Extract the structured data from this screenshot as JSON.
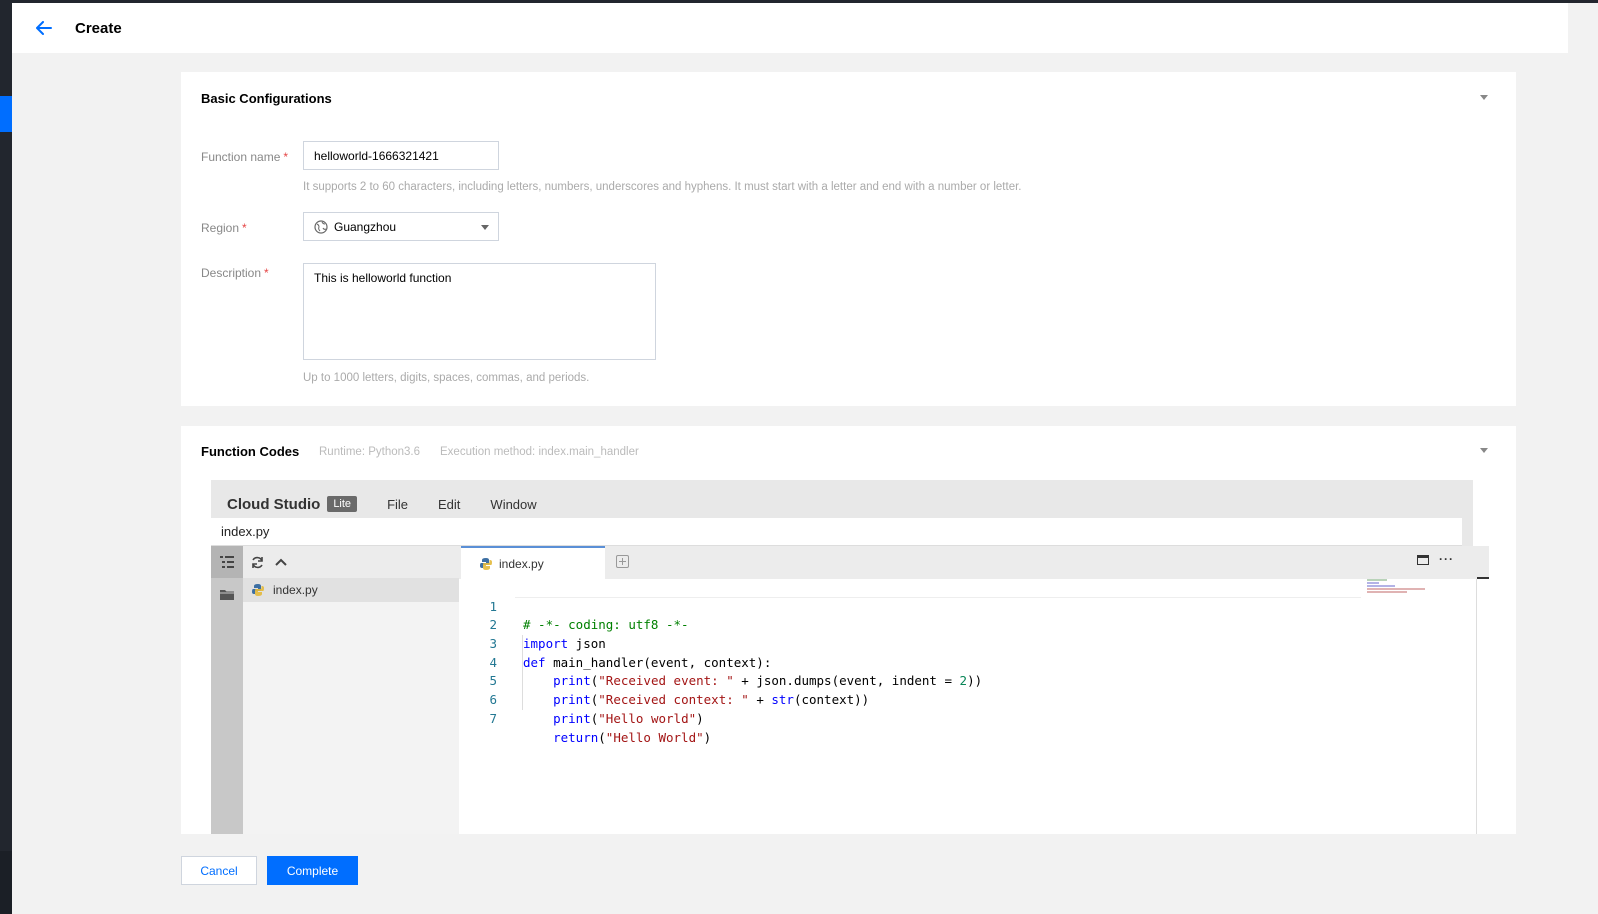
{
  "header": {
    "title": "Create"
  },
  "basic": {
    "title": "Basic Configurations",
    "function_name": {
      "label": "Function name",
      "required_mark": "*",
      "value": "helloworld-1666321421",
      "hint": "It supports 2 to 60 characters, including letters, numbers, underscores and hyphens. It must start with a letter and end with a number or letter."
    },
    "region": {
      "label": "Region",
      "required_mark": "*",
      "value": "Guangzhou"
    },
    "description": {
      "label": "Description",
      "required_mark": "*",
      "value": "This is helloworld function",
      "hint": "Up to 1000 letters, digits, spaces, commas, and periods."
    }
  },
  "code": {
    "title": "Function Codes",
    "runtime": "Runtime: Python3.6",
    "execution_method": "Execution method: index.main_handler"
  },
  "ide": {
    "brand": "Cloud Studio",
    "badge": "Lite",
    "menus": [
      "File",
      "Edit",
      "Window"
    ],
    "current_file": "index.py",
    "explorer_files": [
      "index.py"
    ],
    "tab_label": "index.py",
    "more_label": "···",
    "line_numbers": [
      "1",
      "2",
      "3",
      "4",
      "5",
      "6",
      "7"
    ],
    "code_lines": [
      "# -*- coding: utf8 -*-",
      "import json",
      "def main_handler(event, context):",
      "    print(\"Received event: \" + json.dumps(event, indent = 2))",
      "    print(\"Received context: \" + str(context))",
      "    print(\"Hello world\")",
      "    return(\"Hello World\")"
    ],
    "syntax_colors": {
      "comment": "#008000",
      "keyword": "#0000ff",
      "string": "#a31515",
      "number": "#098658",
      "line_number": "#237893"
    }
  },
  "footer": {
    "cancel_label": "Cancel",
    "complete_label": "Complete"
  },
  "colors": {
    "primary": "#006eff",
    "nav_dark": "#22262e",
    "required": "#e54545"
  },
  "icons": {
    "back": "arrow-left-icon",
    "region": "globe-icon",
    "explorer": "list-tree-icon",
    "folder": "folder-icon",
    "file": "python-file-icon",
    "refresh": "refresh-icon",
    "collapse": "chevron-up-icon"
  }
}
